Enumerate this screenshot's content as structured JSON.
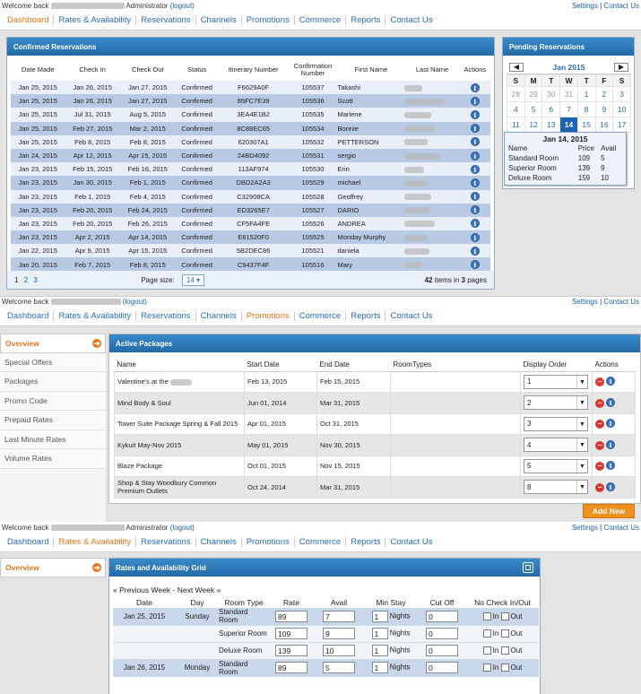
{
  "s1": {
    "welcome": "Welcome back",
    "admin": "Administrator",
    "logout": "(logout)",
    "settings": "Settings",
    "sep": "|",
    "contact": "Contact Us",
    "nav": [
      "Dashboard",
      "Rates & Availability",
      "Reservations",
      "Channels",
      "Promotions",
      "Commerce",
      "Reports",
      "Contact Us"
    ],
    "confirmed_title": "Confirmed Reservations",
    "columns": [
      "Date Made",
      "Check In",
      "Check Out",
      "Status",
      "Itinerary Number",
      "Confirmation Number",
      "First Name",
      "Last Name",
      "Actions"
    ],
    "rows": [
      [
        "Jan 25, 2015",
        "Jan 26, 2015",
        "Jan 27, 2015",
        "Confirmed",
        "F6629A0F",
        "105537",
        "Takashi"
      ],
      [
        "Jan 25, 2015",
        "Jan 26, 2015",
        "Jan 27, 2015",
        "Confirmed",
        "85FC7E39",
        "105536",
        "Scott"
      ],
      [
        "Jan 25, 2015",
        "Jul 31, 2015",
        "Aug 5, 2015",
        "Confirmed",
        "3EA4E1B2",
        "105535",
        "Marlene"
      ],
      [
        "Jan 25, 2015",
        "Feb 27, 2015",
        "Mar 2, 2015",
        "Confirmed",
        "8C88EC65",
        "105534",
        "Bonnie"
      ],
      [
        "Jan 25, 2015",
        "Feb 6, 2015",
        "Feb 8, 2015",
        "Confirmed",
        "620307A1",
        "105532",
        "PETTERSON"
      ],
      [
        "Jan 24, 2015",
        "Apr 12, 2015",
        "Apr 15, 2015",
        "Confirmed",
        "24BD4092",
        "105531",
        "sergio"
      ],
      [
        "Jan 23, 2015",
        "Feb 15, 2015",
        "Feb 16, 2015",
        "Confirmed",
        "113AF974",
        "105530",
        "Erin"
      ],
      [
        "Jan 23, 2015",
        "Jan 30, 2015",
        "Feb 1, 2015",
        "Confirmed",
        "DBD2A2A3",
        "105529",
        "michael"
      ],
      [
        "Jan 23, 2015",
        "Feb 1, 2015",
        "Feb 4, 2015",
        "Confirmed",
        "C32908CA",
        "105528",
        "Geoffrey"
      ],
      [
        "Jan 23, 2015",
        "Feb 20, 2015",
        "Feb 24, 2015",
        "Confirmed",
        "ED3265E7",
        "105527",
        "DARIO"
      ],
      [
        "Jan 23, 2015",
        "Feb 20, 2015",
        "Feb 26, 2015",
        "Confirmed",
        "CF5FA4FE",
        "105526",
        "ANDREA"
      ],
      [
        "Jan 23, 2015",
        "Apr 2, 2015",
        "Apr 14, 2015",
        "Confirmed",
        "E61520F0",
        "105525",
        "Monday Murphy"
      ],
      [
        "Jan 22, 2015",
        "Apr 9, 2015",
        "Apr 15, 2015",
        "Confirmed",
        "5B2DEC86",
        "105521",
        "daniela"
      ],
      [
        "Jan 20, 2015",
        "Feb 7, 2015",
        "Feb 8, 2015",
        "Confirmed",
        "C9437F4F",
        "105516",
        "Mary"
      ]
    ],
    "pages": [
      "1",
      "2",
      "3"
    ],
    "page_size_label": "Page size:",
    "page_size": "14",
    "items_count": "42",
    "items_text": "items in",
    "pages_count": "3",
    "pages_text": "pages",
    "pending_title": "Pending Reservations",
    "cal_month": "Jan 2015",
    "cal_days": [
      "S",
      "M",
      "T",
      "W",
      "T",
      "F",
      "S"
    ],
    "cal_weeks": [
      [
        "28",
        "29",
        "30",
        "31",
        "1",
        "2",
        "3"
      ],
      [
        "4",
        "5",
        "6",
        "7",
        "8",
        "9",
        "10"
      ],
      [
        "11",
        "12",
        "13",
        "14",
        "15",
        "16",
        "17"
      ]
    ],
    "tooltip": {
      "date": "Jan 14, 2015",
      "head": [
        "Name",
        "Price",
        "Avail"
      ],
      "rows": [
        [
          "Standard Room",
          "109",
          "5"
        ],
        [
          "Superior Room",
          "139",
          "9"
        ],
        [
          "Deluxe Room",
          "159",
          "10"
        ]
      ]
    }
  },
  "s2": {
    "welcome": "Welcome back",
    "logout": "(logout)",
    "settings": "Settings",
    "sep": "|",
    "contact": "Contact Us",
    "nav": [
      "Dashboard",
      "Rates & Availability",
      "Reservations",
      "Channels",
      "Promotions",
      "Commerce",
      "Reports",
      "Contact Us"
    ],
    "sidebar": [
      "Overview",
      "Special Offers",
      "Packages",
      "Promo Code",
      "Prepaid Rates",
      "Last Minute Rates",
      "Volume Rates"
    ],
    "title": "Active Packages",
    "columns": [
      "Name",
      "Start Date",
      "End Date",
      "RoomTypes",
      "Display Order",
      "Actions"
    ],
    "rows": [
      [
        "Valentine's at the",
        "Feb 13, 2015",
        "Feb 15, 2015",
        "1"
      ],
      [
        "Mind Body & Soul",
        "Jun 01, 2014",
        "Mar 31, 2015",
        "2"
      ],
      [
        "Tower Suite Package Spring & Fall 2015",
        "Apr 01, 2015",
        "Oct 31, 2015",
        "3"
      ],
      [
        "Kykuit May-Nov 2015",
        "May 01, 2015",
        "Nov 30, 2015",
        "4"
      ],
      [
        "Blaze Package",
        "Oct 01, 2015",
        "Nov 15, 2015",
        "5"
      ],
      [
        "Shop & Stay Woodbury Common Premium Outlets",
        "Oct 24, 2014",
        "Mar 31, 2015",
        "8"
      ]
    ],
    "add_new": "Add New"
  },
  "s3": {
    "welcome": "Welcome back",
    "admin": "Administrator",
    "logout": "(logout)",
    "settings": "Settings",
    "sep": "|",
    "contact": "Contact Us",
    "nav": [
      "Dashboard",
      "Rates & Availability",
      "Reservations",
      "Channels",
      "Promotions",
      "Commerce",
      "Reports",
      "Contact Us"
    ],
    "sidebar_overview": "Overview",
    "title": "Rates and Availability Grid",
    "prev_week": "« Previous Week",
    "dash": "-",
    "next_week": "Next Week »",
    "columns": [
      "Date",
      "Day",
      "Room Type",
      "Rate",
      "Avail",
      "Min Stay",
      "Cut Off",
      "No Check In/Out"
    ],
    "nights": "Nights",
    "in": "In",
    "out": "Out",
    "rows": [
      [
        "Jan 25, 2015",
        "Sunday",
        "Standard Room",
        "89",
        "7",
        "1",
        "0"
      ],
      [
        "",
        "",
        "Superior Room",
        "109",
        "9",
        "1",
        "0"
      ],
      [
        "",
        "",
        "Deluxe Room",
        "139",
        "10",
        "1",
        "0"
      ],
      [
        "Jan 26, 2015",
        "Monday",
        "Standard Room",
        "89",
        "5",
        "1",
        "0"
      ]
    ]
  }
}
